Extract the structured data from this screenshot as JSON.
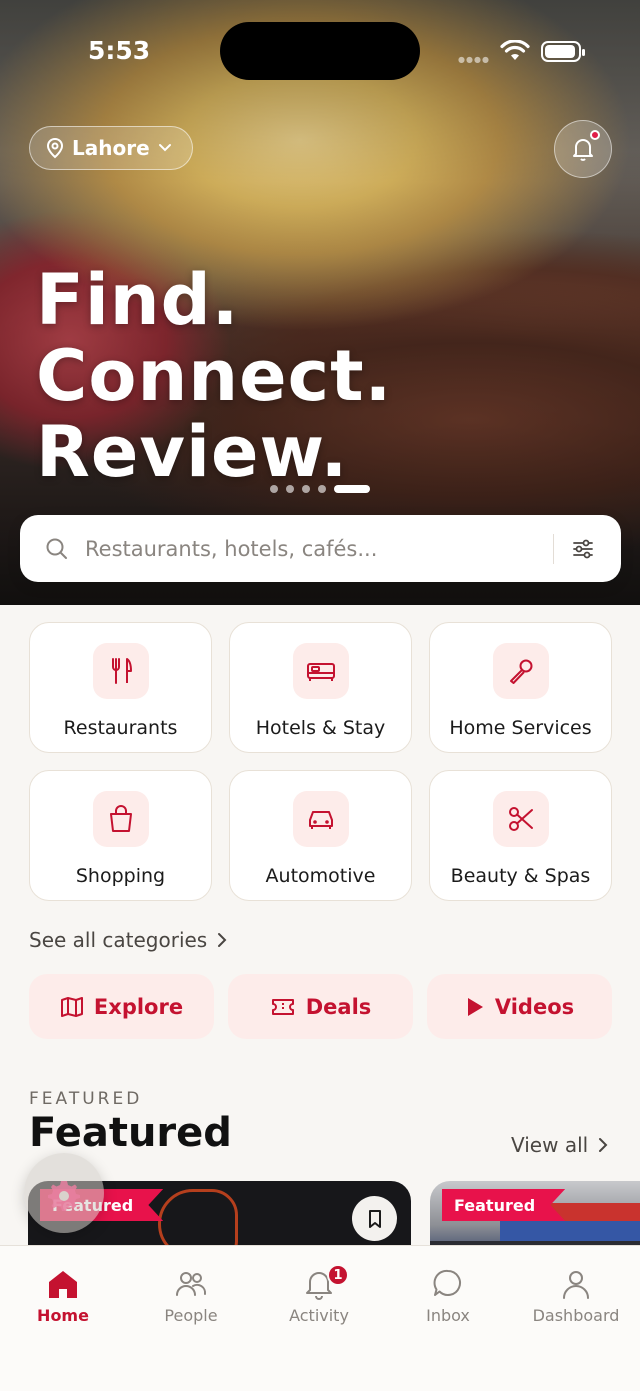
{
  "status_bar": {
    "time": "5:53"
  },
  "header": {
    "location": "Lahore"
  },
  "hero": {
    "headline": [
      "Find.",
      "Connect.",
      "Review."
    ],
    "pager": {
      "count": 5,
      "active_index": 4
    }
  },
  "search": {
    "placeholder": "Restaurants, hotels, cafés..."
  },
  "categories": [
    {
      "label": "Restaurants",
      "icon": "utensils-icon"
    },
    {
      "label": "Hotels & Stay",
      "icon": "bed-icon"
    },
    {
      "label": "Home Services",
      "icon": "wrench-icon"
    },
    {
      "label": "Shopping",
      "icon": "shopping-bag-icon"
    },
    {
      "label": "Automotive",
      "icon": "car-icon"
    },
    {
      "label": "Beauty & Spas",
      "icon": "scissors-icon"
    }
  ],
  "see_all": "See all categories",
  "quick_actions": [
    {
      "label": "Explore",
      "icon": "map-icon"
    },
    {
      "label": "Deals",
      "icon": "ticket-icon"
    },
    {
      "label": "Videos",
      "icon": "play-icon"
    }
  ],
  "featured": {
    "kicker": "FEATURED",
    "title": "Featured",
    "view_all": "View all",
    "cards": [
      {
        "badge": "Featured"
      },
      {
        "badge": "Featured"
      }
    ]
  },
  "tabs": [
    {
      "label": "Home",
      "active": true
    },
    {
      "label": "People",
      "active": false
    },
    {
      "label": "Activity",
      "active": false,
      "badge": "1"
    },
    {
      "label": "Inbox",
      "active": false
    },
    {
      "label": "Dashboard",
      "active": false
    }
  ],
  "colors": {
    "accent": "#c41230",
    "badge": "#e8124b",
    "tint": "#fdecea"
  }
}
